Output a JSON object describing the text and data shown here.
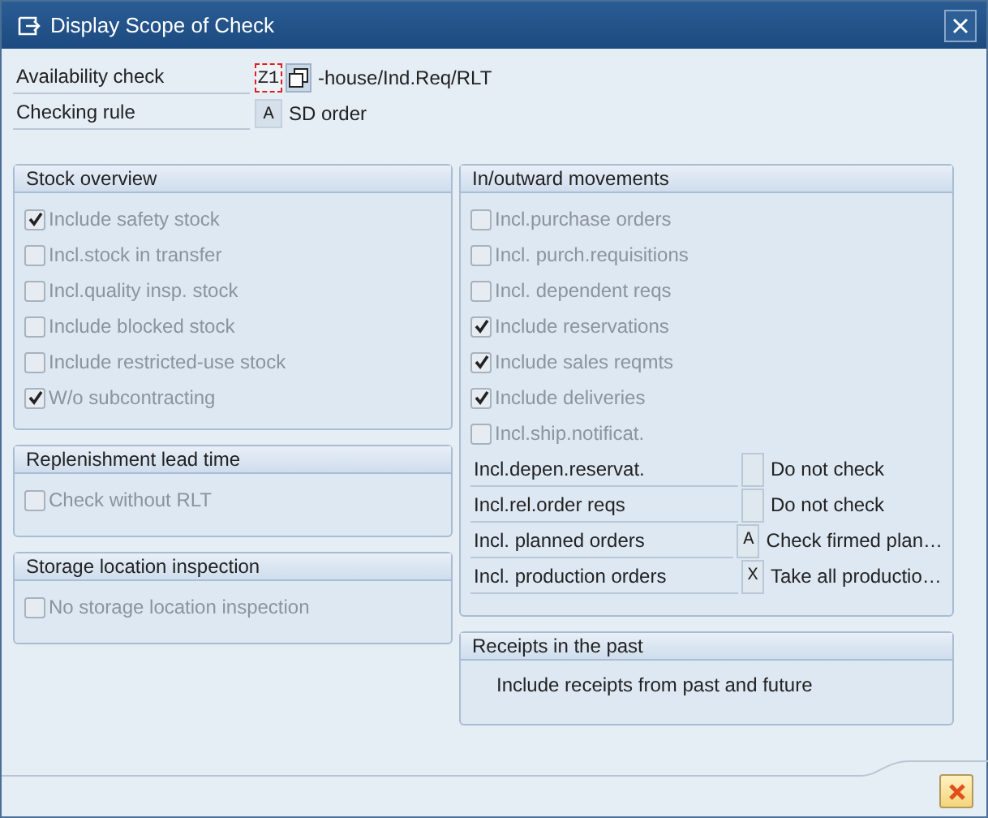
{
  "window": {
    "title": "Display Scope of Check"
  },
  "header_fields": [
    {
      "label": "Availability check",
      "value": "Z1",
      "focused": true,
      "kind": "lookup",
      "description": "-house/Ind.Req/RLT"
    },
    {
      "label": "Checking rule",
      "value": "A",
      "focused": false,
      "kind": "plain",
      "description": "SD order"
    }
  ],
  "columns": [
    {
      "groups": [
        {
          "title": "Stock overview",
          "items": [
            {
              "kind": "checkbox",
              "label": "Include safety stock",
              "checked": true,
              "disabled": true
            },
            {
              "kind": "checkbox",
              "label": "Incl.stock in transfer",
              "checked": false,
              "disabled": true
            },
            {
              "kind": "checkbox",
              "label": "Incl.quality insp. stock",
              "checked": false,
              "disabled": true
            },
            {
              "kind": "checkbox",
              "label": "Include blocked stock",
              "checked": false,
              "disabled": true
            },
            {
              "kind": "checkbox",
              "label": "Include restricted-use stock",
              "checked": false,
              "disabled": true
            },
            {
              "kind": "checkbox",
              "label": "W/o subcontracting",
              "checked": true,
              "disabled": true
            }
          ]
        },
        {
          "title": "Replenishment lead time",
          "items": [
            {
              "kind": "checkbox",
              "label": "Check without RLT",
              "checked": false,
              "disabled": true
            }
          ]
        },
        {
          "title": "Storage location inspection",
          "items": [
            {
              "kind": "checkbox",
              "label": "No storage location inspection",
              "checked": false,
              "disabled": true
            }
          ]
        }
      ]
    },
    {
      "groups": [
        {
          "title": "In/outward movements",
          "items": [
            {
              "kind": "checkbox",
              "label": "Incl.purchase orders",
              "checked": false,
              "disabled": true
            },
            {
              "kind": "checkbox",
              "label": "Incl. purch.requisitions",
              "checked": false,
              "disabled": true
            },
            {
              "kind": "checkbox",
              "label": "Incl. dependent reqs",
              "checked": false,
              "disabled": true
            },
            {
              "kind": "checkbox",
              "label": "Include reservations",
              "checked": true,
              "disabled": true
            },
            {
              "kind": "checkbox",
              "label": "Include sales reqmts",
              "checked": true,
              "disabled": true
            },
            {
              "kind": "checkbox",
              "label": "Include deliveries",
              "checked": true,
              "disabled": true
            },
            {
              "kind": "checkbox",
              "label": "Incl.ship.notificat.",
              "checked": false,
              "disabled": true
            },
            {
              "kind": "code",
              "label": "Incl.depen.reservat.",
              "description": "Do not check"
            },
            {
              "kind": "code",
              "label": "Incl.rel.order reqs",
              "description": "Do not check"
            },
            {
              "kind": "code",
              "label": "Incl. planned orders",
              "value": "A",
              "description": "Check firmed plan…"
            },
            {
              "kind": "code",
              "label": "Incl. production orders",
              "value": "X",
              "description": "Take all productio…"
            }
          ]
        },
        {
          "title": "Receipts in the past",
          "items": [
            {
              "kind": "text",
              "label": "Include receipts from past and future"
            }
          ]
        }
      ]
    }
  ]
}
